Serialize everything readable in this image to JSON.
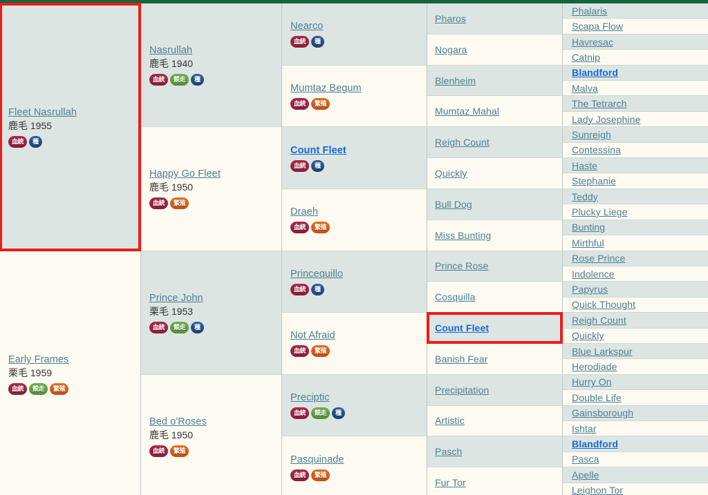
{
  "page": {
    "type": "horse-pedigree-table",
    "generations": 5,
    "top_bar_color": "#14663a",
    "link_color": "#4b7f94",
    "highlight_link_color": "#1668d8",
    "row_tone_a": "#dde5e3",
    "row_tone_b": "#fdfaf2",
    "highlight_box_color": "#ee1b1b"
  },
  "badge_labels": {
    "ketto": "血統",
    "kyoso": "競走",
    "tane": "種",
    "hanshoku": "繁殖"
  },
  "gen1": [
    {
      "name": "Fleet Nasrullah",
      "meta": "鹿毛 1955",
      "badges": [
        "ketto",
        "tane"
      ],
      "tone": "a",
      "highlighted": false,
      "boxed": true
    },
    {
      "name": "Early Frames",
      "meta": "栗毛 1959",
      "badges": [
        "ketto",
        "kyoso",
        "hanshoku"
      ],
      "tone": "b",
      "highlighted": false,
      "boxed": false
    }
  ],
  "gen2": [
    {
      "name": "Nasrullah",
      "meta": "鹿毛 1940",
      "badges": [
        "ketto",
        "kyoso",
        "tane"
      ],
      "tone": "a",
      "highlighted": false
    },
    {
      "name": "Happy Go Fleet",
      "meta": "鹿毛 1950",
      "badges": [
        "ketto",
        "hanshoku"
      ],
      "tone": "b",
      "highlighted": false
    },
    {
      "name": "Prince John",
      "meta": "栗毛 1953",
      "badges": [
        "ketto",
        "kyoso",
        "tane"
      ],
      "tone": "a",
      "highlighted": false
    },
    {
      "name": "Bed o'Roses",
      "meta": "鹿毛 1950",
      "badges": [
        "ketto",
        "hanshoku"
      ],
      "tone": "b",
      "highlighted": false
    }
  ],
  "gen3": [
    {
      "name": "Nearco",
      "meta": "",
      "badges": [
        "ketto",
        "tane"
      ],
      "tone": "a",
      "highlighted": false
    },
    {
      "name": "Mumtaz Begum",
      "meta": "",
      "badges": [
        "ketto",
        "hanshoku"
      ],
      "tone": "b",
      "highlighted": false
    },
    {
      "name": "Count Fleet",
      "meta": "",
      "badges": [
        "ketto",
        "tane"
      ],
      "tone": "a",
      "highlighted": true
    },
    {
      "name": "Draeh",
      "meta": "",
      "badges": [
        "ketto",
        "hanshoku"
      ],
      "tone": "b",
      "highlighted": false
    },
    {
      "name": "Princequillo",
      "meta": "",
      "badges": [
        "ketto",
        "tane"
      ],
      "tone": "a",
      "highlighted": false
    },
    {
      "name": "Not Afraid",
      "meta": "",
      "badges": [
        "ketto",
        "hanshoku"
      ],
      "tone": "b",
      "highlighted": false
    },
    {
      "name": "Preciptic",
      "meta": "",
      "badges": [
        "ketto",
        "kyoso",
        "tane"
      ],
      "tone": "a",
      "highlighted": false
    },
    {
      "name": "Pasquinade",
      "meta": "",
      "badges": [
        "ketto",
        "hanshoku"
      ],
      "tone": "b",
      "highlighted": false
    }
  ],
  "gen4": [
    {
      "name": "Pharos",
      "tone": "a",
      "highlighted": false,
      "boxed": false
    },
    {
      "name": "Nogara",
      "tone": "b",
      "highlighted": false,
      "boxed": false
    },
    {
      "name": "Blenheim",
      "tone": "a",
      "highlighted": false,
      "boxed": false
    },
    {
      "name": "Mumtaz Mahal",
      "tone": "b",
      "highlighted": false,
      "boxed": false
    },
    {
      "name": "Reigh Count",
      "tone": "a",
      "highlighted": false,
      "boxed": false
    },
    {
      "name": "Quickly",
      "tone": "b",
      "highlighted": false,
      "boxed": false
    },
    {
      "name": "Bull Dog",
      "tone": "a",
      "highlighted": false,
      "boxed": false
    },
    {
      "name": "Miss Bunting",
      "tone": "b",
      "highlighted": false,
      "boxed": false
    },
    {
      "name": "Prince Rose",
      "tone": "a",
      "highlighted": false,
      "boxed": false
    },
    {
      "name": "Cosquilla",
      "tone": "b",
      "highlighted": false,
      "boxed": false
    },
    {
      "name": "Count Fleet",
      "tone": "a",
      "highlighted": true,
      "boxed": true
    },
    {
      "name": "Banish Fear",
      "tone": "b",
      "highlighted": false,
      "boxed": false
    },
    {
      "name": "Precipitation",
      "tone": "a",
      "highlighted": false,
      "boxed": false
    },
    {
      "name": "Artistic",
      "tone": "b",
      "highlighted": false,
      "boxed": false
    },
    {
      "name": "Pasch",
      "tone": "a",
      "highlighted": false,
      "boxed": false
    },
    {
      "name": "Fur Tor",
      "tone": "b",
      "highlighted": false,
      "boxed": false
    }
  ],
  "gen5": [
    {
      "name": "Phalaris",
      "tone": "a",
      "highlighted": false
    },
    {
      "name": "Scapa Flow",
      "tone": "b",
      "highlighted": false
    },
    {
      "name": "Havresac",
      "tone": "a",
      "highlighted": false
    },
    {
      "name": "Catnip",
      "tone": "b",
      "highlighted": false
    },
    {
      "name": "Blandford",
      "tone": "a",
      "highlighted": true
    },
    {
      "name": "Malva",
      "tone": "b",
      "highlighted": false
    },
    {
      "name": "The Tetrarch",
      "tone": "a",
      "highlighted": false
    },
    {
      "name": "Lady Josephine",
      "tone": "b",
      "highlighted": false
    },
    {
      "name": "Sunreigh",
      "tone": "a",
      "highlighted": false
    },
    {
      "name": "Contessina",
      "tone": "b",
      "highlighted": false
    },
    {
      "name": "Haste",
      "tone": "a",
      "highlighted": false
    },
    {
      "name": "Stephanie",
      "tone": "b",
      "highlighted": false
    },
    {
      "name": "Teddy",
      "tone": "a",
      "highlighted": false
    },
    {
      "name": "Plucky Liege",
      "tone": "b",
      "highlighted": false
    },
    {
      "name": "Bunting",
      "tone": "a",
      "highlighted": false
    },
    {
      "name": "Mirthful",
      "tone": "b",
      "highlighted": false
    },
    {
      "name": "Rose Prince",
      "tone": "a",
      "highlighted": false
    },
    {
      "name": "Indolence",
      "tone": "b",
      "highlighted": false
    },
    {
      "name": "Papyrus",
      "tone": "a",
      "highlighted": false
    },
    {
      "name": "Quick Thought",
      "tone": "b",
      "highlighted": false
    },
    {
      "name": "Reigh Count",
      "tone": "a",
      "highlighted": false
    },
    {
      "name": "Quickly",
      "tone": "b",
      "highlighted": false
    },
    {
      "name": "Blue Larkspur",
      "tone": "a",
      "highlighted": false
    },
    {
      "name": "Herodiade",
      "tone": "b",
      "highlighted": false
    },
    {
      "name": "Hurry On",
      "tone": "a",
      "highlighted": false
    },
    {
      "name": "Double Life",
      "tone": "b",
      "highlighted": false
    },
    {
      "name": "Gainsborough",
      "tone": "a",
      "highlighted": false
    },
    {
      "name": "Ishtar",
      "tone": "b",
      "highlighted": false
    },
    {
      "name": "Blandford",
      "tone": "a",
      "highlighted": true
    },
    {
      "name": "Pasca",
      "tone": "b",
      "highlighted": false
    },
    {
      "name": "Apelle",
      "tone": "a",
      "highlighted": false
    },
    {
      "name": "Leighon Tor",
      "tone": "b",
      "highlighted": false
    }
  ]
}
